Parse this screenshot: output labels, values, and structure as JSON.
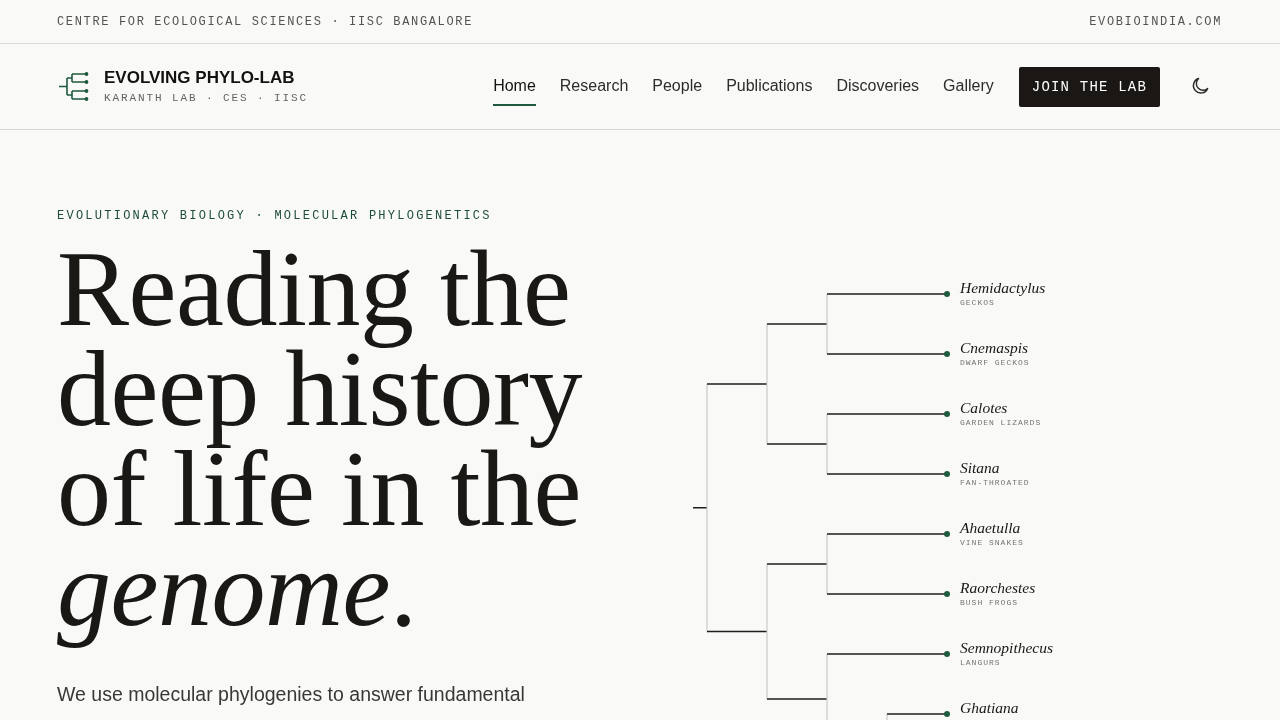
{
  "top_bar": {
    "institution": "CENTRE FOR ECOLOGICAL SCIENCES · IISC BANGALORE",
    "website": "EVOBIOINDIA.COM"
  },
  "header": {
    "logo": {
      "title": "EVOLVING PHYLO-LAB",
      "subtitle": "KARANTH LAB · CES · IISC"
    },
    "nav": [
      {
        "label": "Home",
        "selected": true
      },
      {
        "label": "Research",
        "selected": false
      },
      {
        "label": "People",
        "selected": false
      },
      {
        "label": "Publications",
        "selected": false
      },
      {
        "label": "Discoveries",
        "selected": false
      },
      {
        "label": "Gallery",
        "selected": false
      }
    ],
    "cta": "JOIN THE LAB"
  },
  "hero": {
    "kicker": "EVOLUTIONARY BIOLOGY · MOLECULAR PHYLOGENETICS",
    "heading": "Reading the deep history of life in the *genome*.",
    "description": "We use molecular phylogenies to answer fundamental",
    "tree": {
      "children": [
        {
          "children": [
            {
              "children": [
                {
                  "name": "Hemidactylus",
                  "common_name": "GECKOS"
                },
                {
                  "name": "Cnemaspis",
                  "common_name": "DWARF GECKOS"
                }
              ]
            },
            {
              "children": [
                {
                  "name": "Calotes",
                  "common_name": "GARDEN LIZARDS"
                },
                {
                  "name": "Sitana",
                  "common_name": "FAN-THROATED"
                }
              ]
            }
          ]
        },
        {
          "children": [
            {
              "children": [
                {
                  "name": "Ahaetulla",
                  "common_name": "VINE SNAKES"
                },
                {
                  "name": "Raorchestes",
                  "common_name": "BUSH FROGS"
                }
              ]
            },
            {
              "children": [
                {
                  "name": "Semnopithecus",
                  "common_name": "LANGURS"
                },
                {
                  "children": [
                    {
                      "name": "Ghatiana"
                    }
                  ]
                }
              ]
            }
          ]
        }
      ]
    }
  }
}
